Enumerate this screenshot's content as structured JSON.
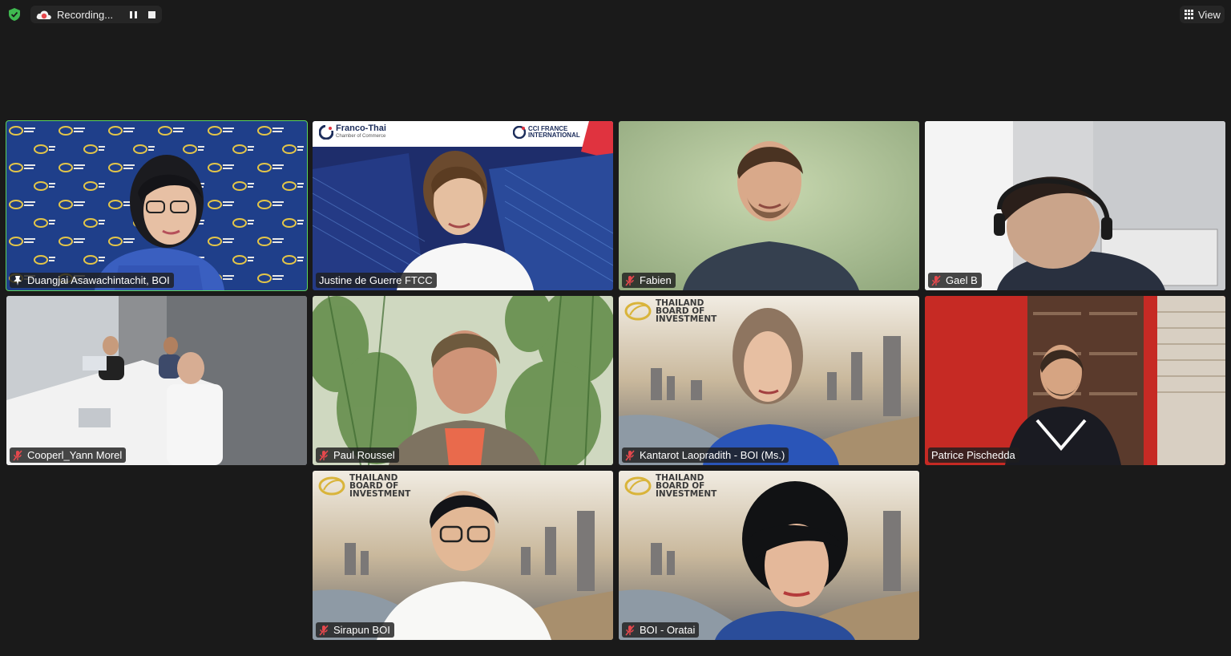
{
  "topbar": {
    "recording_label": "Recording...",
    "view_label": "View",
    "security_color": "#3fb950",
    "recording_color": "#e5484d"
  },
  "participants": [
    {
      "name": "Duangjai Asawachintachit, BOI",
      "mic": "pinned-icon",
      "active_speaker": true
    },
    {
      "name": "Justine de Guerre FTCC",
      "mic": "none"
    },
    {
      "name": "Fabien",
      "mic": "muted-mic-icon"
    },
    {
      "name": "Gael B",
      "mic": "muted-mic-icon"
    },
    {
      "name": "Cooperl_Yann Morel",
      "mic": "muted-mic-icon"
    },
    {
      "name": "Paul Roussel",
      "mic": "muted-mic-icon"
    },
    {
      "name": "Kantarot Laopradith - BOI (Ms.)",
      "mic": "muted-mic-icon"
    },
    {
      "name": "Patrice Pischedda",
      "mic": "none"
    },
    {
      "name": "Sirapun BOI",
      "mic": "muted-mic-icon"
    },
    {
      "name": "BOI - Oratai",
      "mic": "muted-mic-icon"
    }
  ],
  "backgrounds": {
    "boi_logo_lines": [
      "THAILAND",
      "BOARD OF",
      "INVESTMENT"
    ],
    "ftcc_title": "Franco-Thai",
    "ftcc_subtitle": "Chamber of Commerce",
    "cci_lines": [
      "CCI FRANCE",
      "INTERNATIONAL"
    ]
  }
}
